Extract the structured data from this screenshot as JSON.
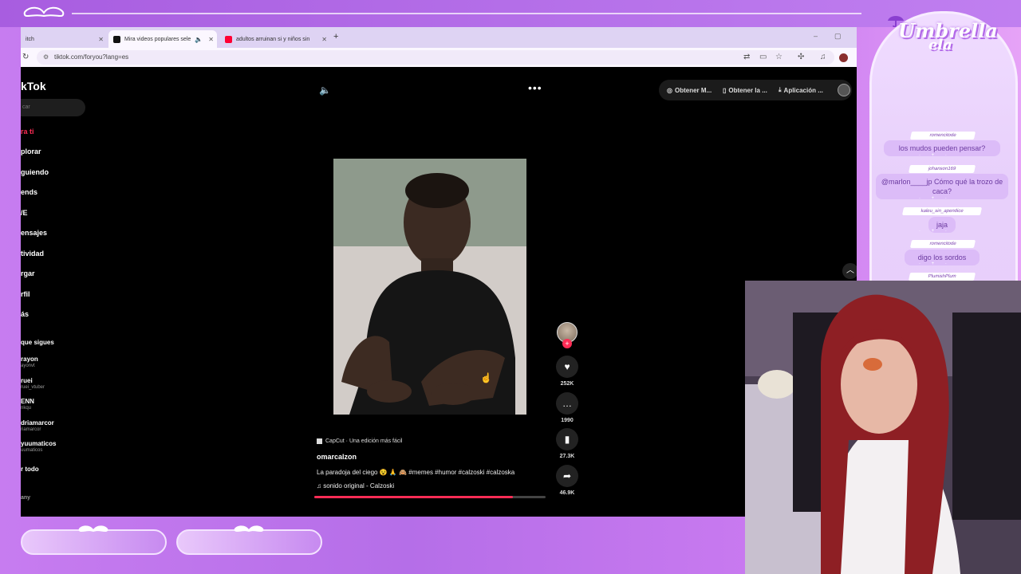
{
  "browser": {
    "tabs": [
      {
        "label": "itch"
      },
      {
        "label": "Mira videos populares sele"
      },
      {
        "label": "adultos arruinan si y niños sin"
      }
    ],
    "url": "tiktok.com/foryou?lang=es"
  },
  "tiktok": {
    "logo": "kTok",
    "search_placeholder": "car",
    "nav": [
      "ra ti",
      "plorar",
      "guiendo",
      "ends",
      "/E",
      "ensajes",
      "tividad",
      "rgar",
      "rfil",
      "ás"
    ],
    "following_heading": "que sigues",
    "following": [
      {
        "name": "rayon",
        "handle": "ayonvt"
      },
      {
        "name": "ruei",
        "handle": "ruei_vtuber"
      },
      {
        "name": "ENN",
        "handle": "nkqu"
      },
      {
        "name": "driamarcor",
        "handle": "riamarcor"
      },
      {
        "name": "yuumaticos",
        "handle": "uumaticos"
      }
    ],
    "see_all": "r todo",
    "company": "any",
    "header_buttons": [
      "Obtener M...",
      "Obtener la ...",
      "Aplicación ..."
    ],
    "capcut": "CapCut · Una edición más fácil",
    "author": "omarcalzon",
    "description": "La paradoja del ciego 😵 🙏 🙈 #memes #humor #calzoski #calzoska",
    "sound": "sonido original - Calzoski",
    "progress": 0.86,
    "actions": {
      "likes": "252K",
      "comments": "1990",
      "saves": "27.3K",
      "shares": "46.9K"
    },
    "icons": {
      "volume": "volume-icon",
      "more": "more-icon"
    }
  },
  "chat": {
    "brand_line1": "Umbrella",
    "brand_line2": "ela",
    "messages": [
      {
        "user": "romencitode",
        "text": "los mudos pueden pensar?"
      },
      {
        "user": "johanson169",
        "text": "@marlon____jp Cómo qué la trozo de caca?"
      },
      {
        "user": "kaleu_sin_apendice",
        "text": "jaja"
      },
      {
        "user": "romencitode",
        "text": "digo los sordos"
      },
      {
        "user": "PlumishPlum",
        "text": ""
      }
    ]
  },
  "colors": {
    "accent": "#fe2c55",
    "overlay": "#c77cf0"
  }
}
